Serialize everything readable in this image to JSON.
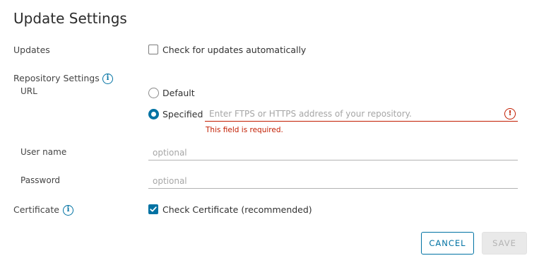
{
  "dialog": {
    "title": "Update Settings"
  },
  "updates": {
    "label": "Updates",
    "checkbox_label": "Check for updates automatically",
    "checked": false
  },
  "repository": {
    "label": "Repository Settings",
    "url_label": "URL",
    "default_option": "Default",
    "specified_option": "Specified",
    "selected": "Specified",
    "url_placeholder": "Enter FTPS or HTTPS address of your repository.",
    "url_value": "",
    "url_error": "This field is required.",
    "username_label": "User name",
    "username_placeholder": "optional",
    "password_label": "Password",
    "password_placeholder": "optional"
  },
  "certificate": {
    "label": "Certificate",
    "checkbox_label": "Check Certificate (recommended)",
    "checked": true
  },
  "buttons": {
    "cancel": "CANCEL",
    "save": "SAVE"
  },
  "icons": {
    "info": "info-icon",
    "error": "error-icon",
    "check": "checkmark-icon"
  },
  "colors": {
    "accent": "#0072a3",
    "error": "#c21d00"
  }
}
